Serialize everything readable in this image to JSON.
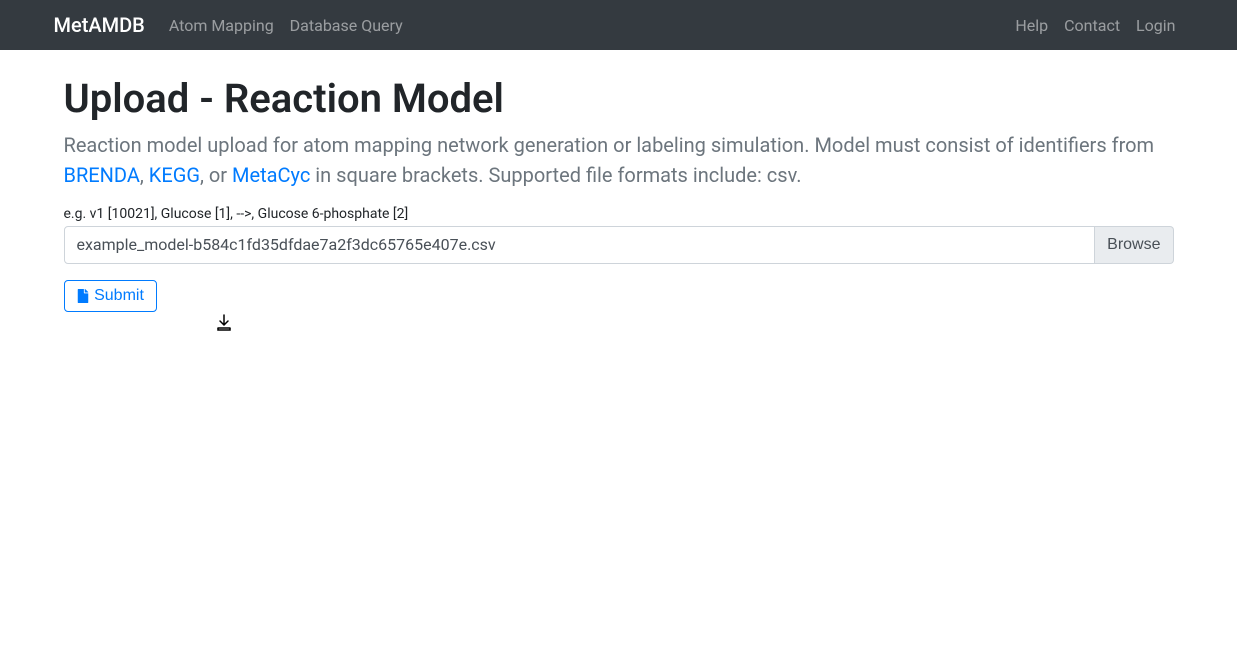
{
  "navbar": {
    "brand": "MetAMDB",
    "left_links": [
      "Atom Mapping",
      "Database Query"
    ],
    "right_links": [
      "Help",
      "Contact",
      "Login"
    ]
  },
  "page": {
    "title": "Upload - Reaction Model",
    "description_part1": "Reaction model upload for atom mapping network generation or labeling simulation. Model must consist of identifiers from ",
    "link_brenda": "BRENDA",
    "description_sep1": ", ",
    "link_kegg": "KEGG",
    "description_sep2": ", or ",
    "link_metacyc": "MetaCyc",
    "description_part2": " in square brackets. Supported file formats include: csv."
  },
  "form": {
    "label": "e.g. v1 [10021], Glucose [1], -->, Glucose 6-phosphate [2]",
    "file_value": "example_model-b584c1fd35dfdae7a2f3dc65765e407e.csv",
    "browse_label": "Browse",
    "submit_label": "Submit"
  }
}
